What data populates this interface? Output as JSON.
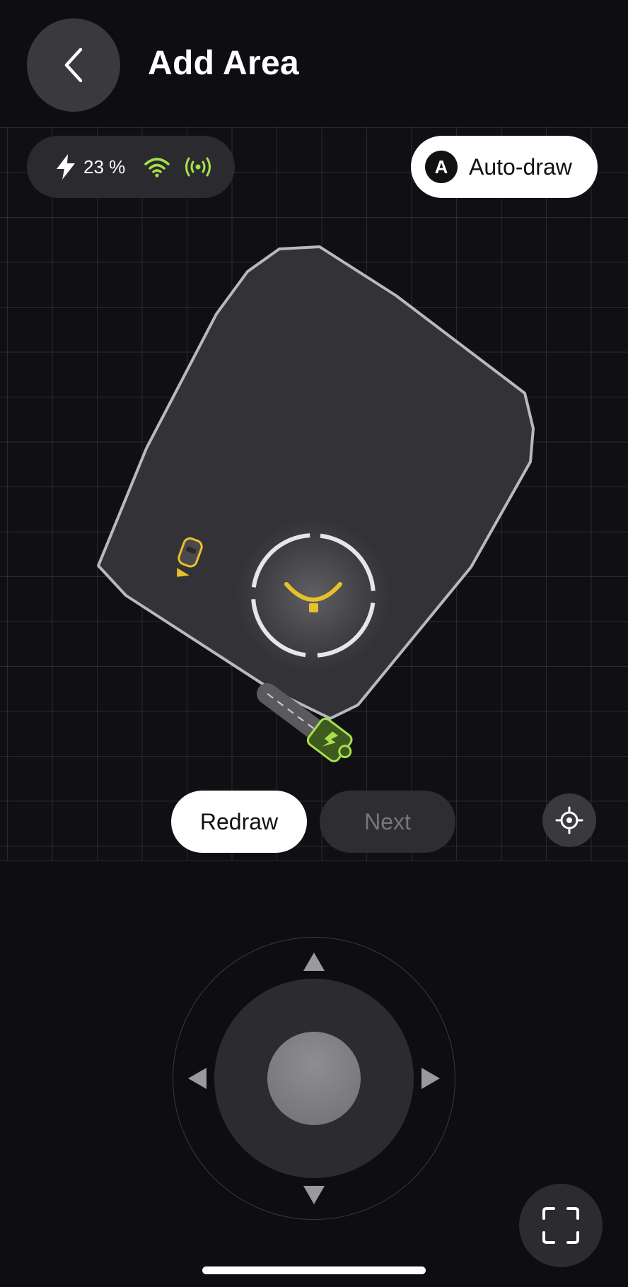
{
  "header": {
    "title": "Add Area"
  },
  "status": {
    "battery": "23 %",
    "wifi_color": "#a6e04a",
    "signal_color": "#a6e04a"
  },
  "map": {
    "auto_draw_badge": "A",
    "auto_draw_label": "Auto-draw",
    "area_fill": "#333337",
    "area_outline": "#b9b9bd",
    "mower_color": "#e8c12a",
    "dock_color": "#a6e04a"
  },
  "actions": {
    "redraw_label": "Redraw",
    "next_label": "Next"
  },
  "icons": {
    "back": "chevron-left-icon",
    "battery": "lightning-icon",
    "wifi": "wifi-icon",
    "signal": "signal-broadcast-icon",
    "locate": "crosshair-icon",
    "fullscreen": "fullscreen-icon"
  }
}
